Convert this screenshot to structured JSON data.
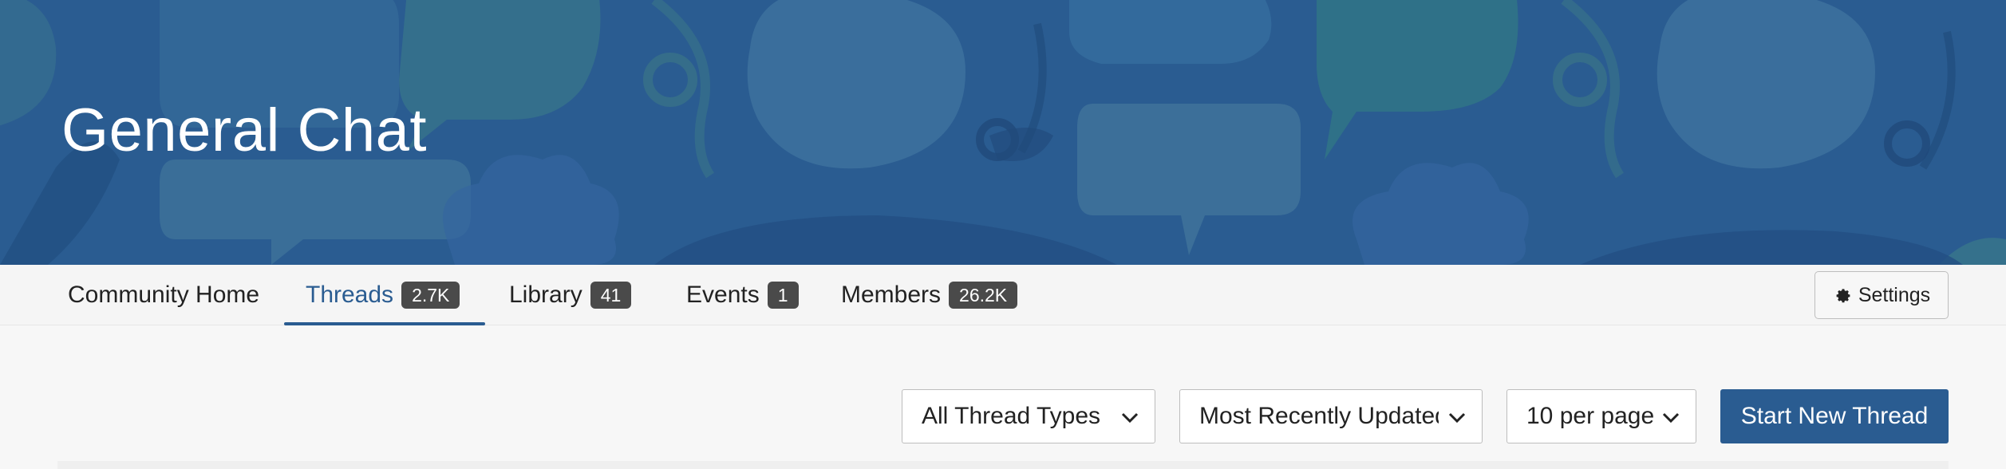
{
  "banner": {
    "title": "General Chat"
  },
  "nav": {
    "items": [
      {
        "label": "Community Home",
        "badge": ""
      },
      {
        "label": "Threads",
        "badge": "2.7K"
      },
      {
        "label": "Library",
        "badge": "41"
      },
      {
        "label": "Events",
        "badge": "1"
      },
      {
        "label": "Members",
        "badge": "26.2K"
      }
    ],
    "active": "Threads",
    "settings_label": "Settings"
  },
  "controls": {
    "thread_type": "All Thread Types",
    "sort": "Most Recently Updated",
    "per_page": "10 per page",
    "start_thread_label": "Start New Thread"
  },
  "icons": {
    "settings": "gear-icon",
    "dropdown": "chevron-down-icon"
  },
  "colors": {
    "brand": "#2a5c91",
    "badge": "#4a4a4a",
    "nav_background": "#f5f5f5"
  }
}
